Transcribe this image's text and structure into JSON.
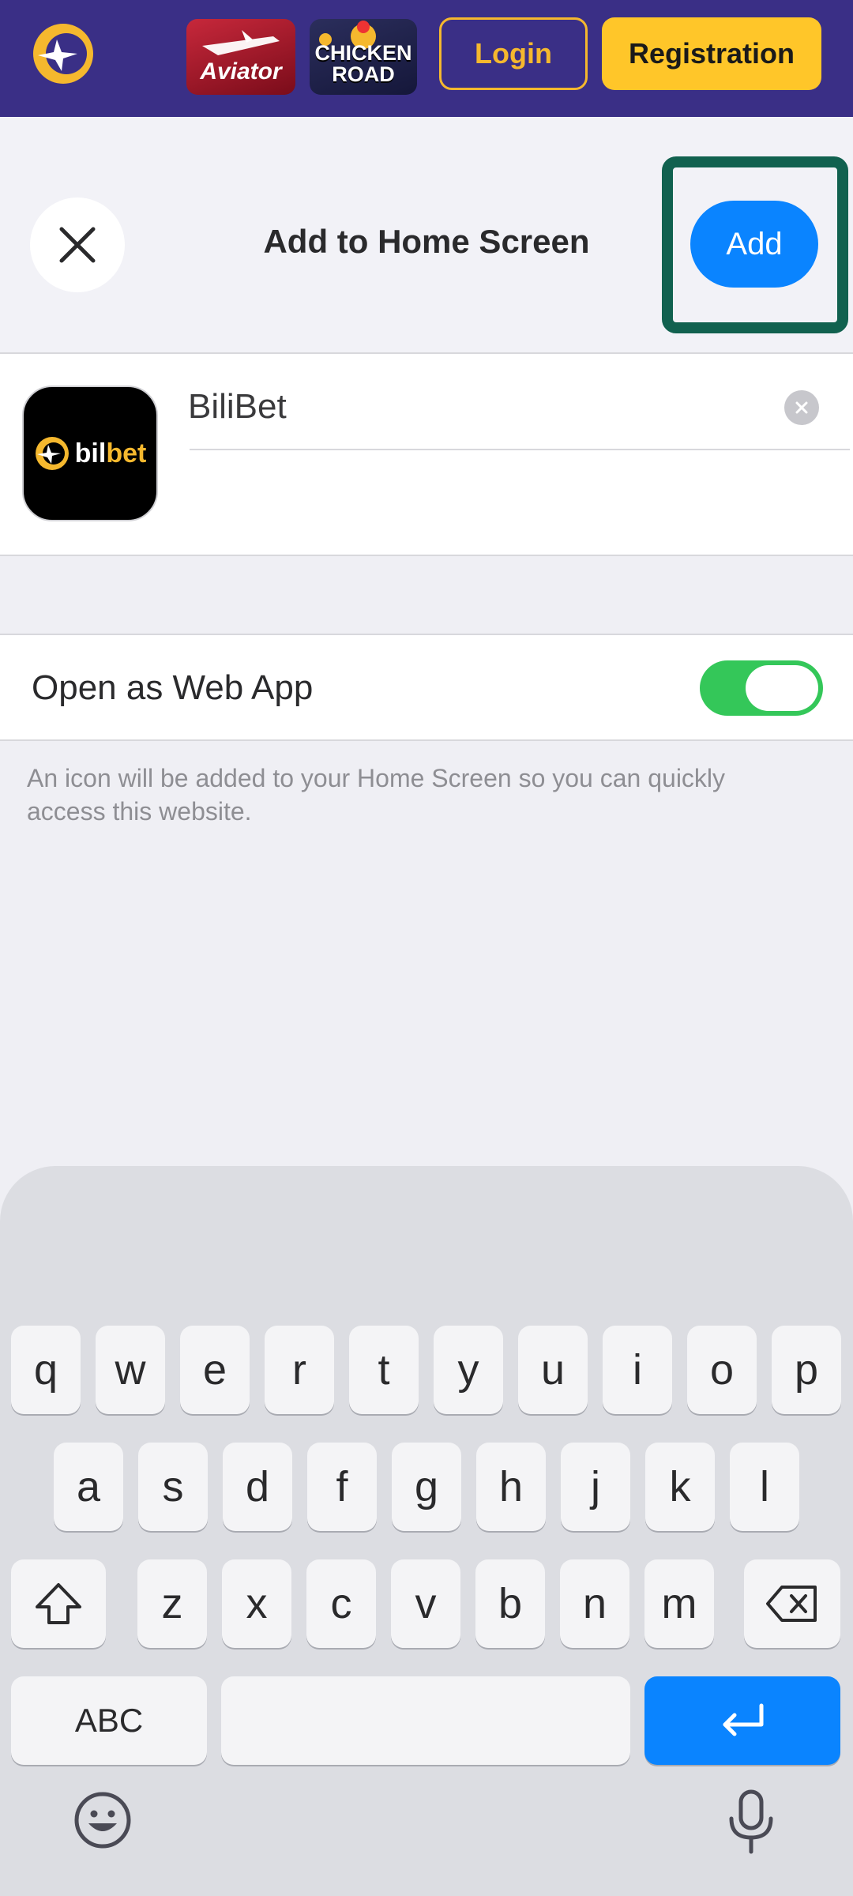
{
  "site_header": {
    "game1_label": "Aviator",
    "game2_label_line1": "CHICKEN",
    "game2_label_line2": "ROAD",
    "login_label": "Login",
    "register_label": "Registration"
  },
  "sheet": {
    "title": "Add to Home Screen",
    "add_label": "Add",
    "app_name": "BiliBet",
    "icon_text_a": "bil",
    "icon_text_b": "bet",
    "toggle_label": "Open as Web App",
    "toggle_on": true,
    "helper": "An icon will be added to your Home Screen so you can quickly access this website."
  },
  "keyboard": {
    "row1": [
      "q",
      "w",
      "e",
      "r",
      "t",
      "y",
      "u",
      "i",
      "o",
      "p"
    ],
    "row2": [
      "a",
      "s",
      "d",
      "f",
      "g",
      "h",
      "j",
      "k",
      "l"
    ],
    "row3": [
      "z",
      "x",
      "c",
      "v",
      "b",
      "n",
      "m"
    ],
    "abc_label": "ABC"
  },
  "colors": {
    "header_bg": "#3a2f86",
    "accent_gold": "#ffc629",
    "ios_blue": "#0a84ff",
    "toggle_green": "#34c759",
    "highlight": "#11614f"
  }
}
